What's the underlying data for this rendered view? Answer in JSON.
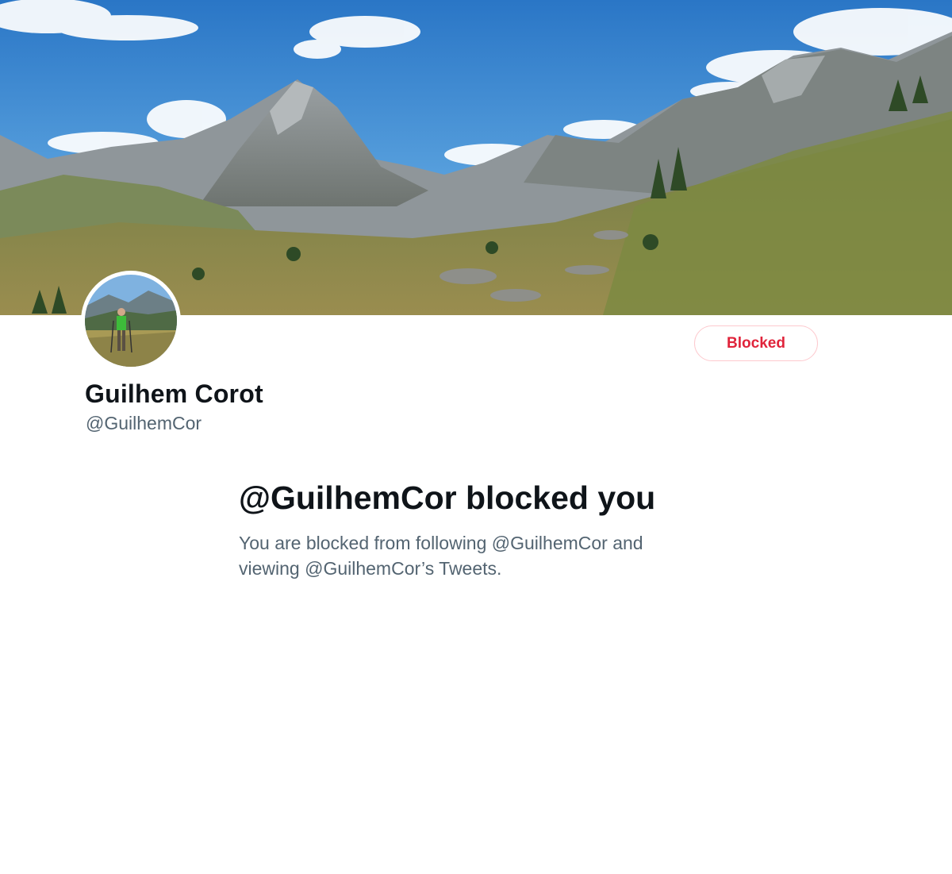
{
  "profile": {
    "display_name": "Guilhem Corot",
    "handle": "@GuilhemCor",
    "banner_icon": "mountain-landscape-photo",
    "avatar_icon": "hiker-photo"
  },
  "actions": {
    "blocked_label": "Blocked"
  },
  "notice": {
    "title": "@GuilhemCor blocked you",
    "body": "You are blocked from following @GuilhemCor and viewing @GuilhemCor’s Tweets."
  },
  "colors": {
    "blocked_red": "#e0243b",
    "secondary_text": "#536471",
    "primary_text": "#0f1419"
  }
}
